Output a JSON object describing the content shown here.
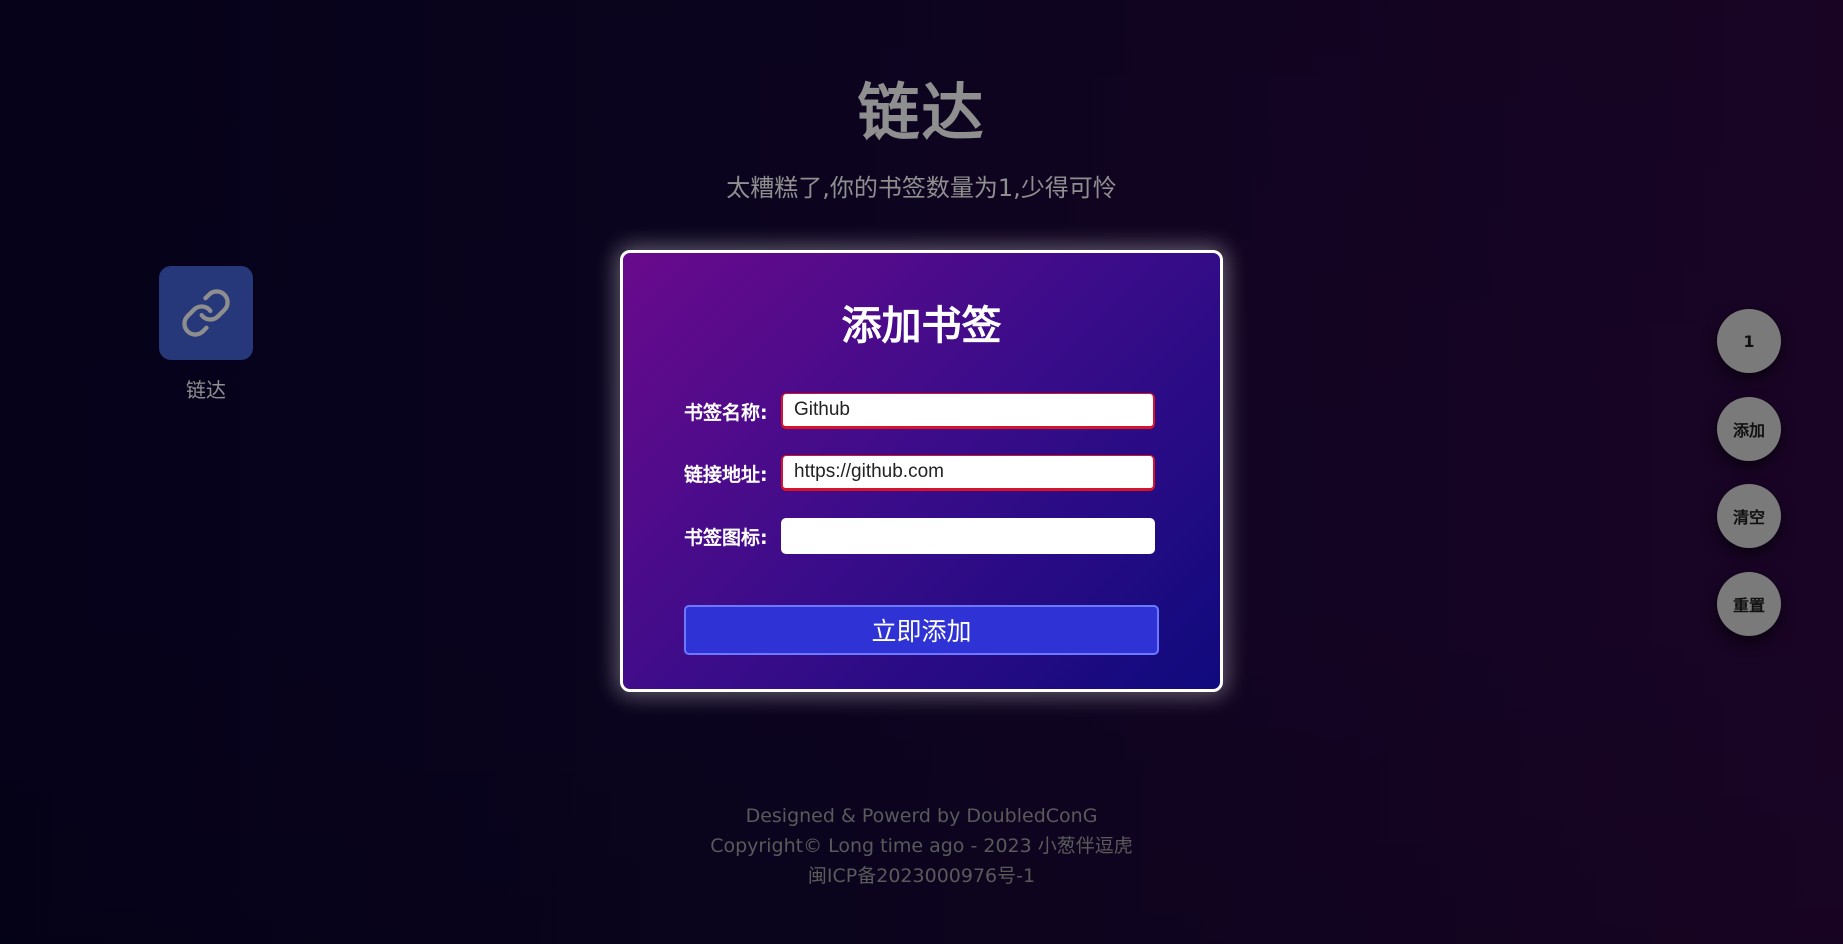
{
  "header": {
    "title": "链达",
    "subtitle": "太糟糕了,你的书签数量为1,少得可怜"
  },
  "bookmarks": [
    {
      "label": "链达",
      "icon": "link-icon",
      "icon_bg": "#26377a"
    }
  ],
  "form": {
    "title": "添加书签",
    "fields": [
      {
        "label": "书签名称:",
        "value": "Github",
        "placeholder": ""
      },
      {
        "label": "链接地址:",
        "value": "https://github.com",
        "placeholder": ""
      },
      {
        "label": "书签图标:",
        "value": "",
        "placeholder": ""
      }
    ],
    "submit_label": "立即添加"
  },
  "side_buttons": {
    "count": "1",
    "add": "添加",
    "clear": "清空",
    "reset": "重置"
  },
  "footer": {
    "line1": "Designed & Powerd by DoubledConG",
    "line2": "Copyright© Long time ago - 2023 小葱伴逗虎",
    "line3": "闽ICP备2023000976号-1"
  },
  "colors": {
    "card_border": "#ffffff",
    "submit_bg": "#2f33d5",
    "invalid_border": "#d6132b",
    "side_button_bg": "#7a7a7a"
  }
}
